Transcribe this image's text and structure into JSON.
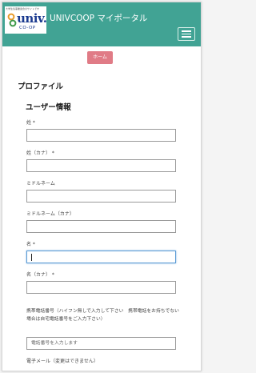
{
  "header": {
    "logo_small": "大学生協事業連合のサイトです",
    "logo_main": "univ.",
    "logo_co": "CO-OP",
    "title": "UNIVCOOP マイポータル"
  },
  "nav": {
    "home_label": "ホーム"
  },
  "page": {
    "title": "プロファイル",
    "section_title": "ユーザー情報"
  },
  "fields": [
    {
      "label": "姓 *"
    },
    {
      "label": "姓（カナ） *"
    },
    {
      "label": "ミドルネーム"
    },
    {
      "label": "ミドルネーム（カナ）"
    },
    {
      "label": "名 *"
    },
    {
      "label": "名（カナ） *"
    }
  ],
  "phone": {
    "note": "携帯電話番号（ハイフン無しで入力して下さい　携帯電話をお持ちでない場合は自宅電話番号をご入力下さい）",
    "placeholder": "電話番号を入力します"
  },
  "email": {
    "label": "電子メール（変更はできません）"
  },
  "colors": {
    "header": "#41a394",
    "home_button": "#e07b86",
    "logo_text": "#1a3a8f",
    "focus_border": "#5b9bd5"
  },
  "icons": {
    "menu": "hamburger-menu-icon",
    "logo": "univcoop-logo-icon"
  }
}
